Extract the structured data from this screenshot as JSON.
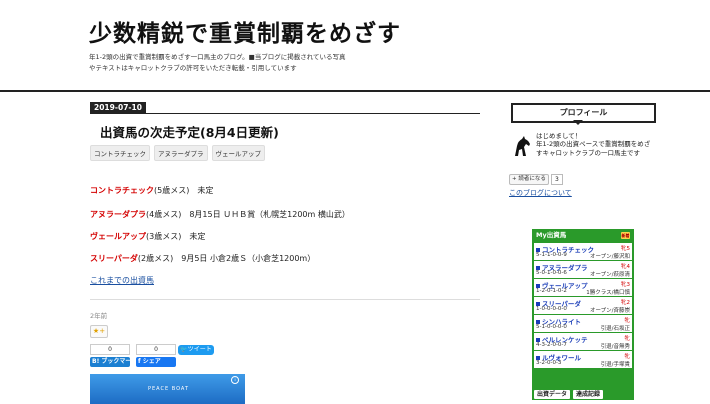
{
  "header": {
    "site_title": "少数精鋭で重賞制覇をめざす",
    "description_line1": "年1-2頭の出資で重賞制覇をめざす一口馬主のブログ。■当ブログに掲載されている写真",
    "description_line2": "やテキストはキャロットクラブの許可をいただき転載・引用しています"
  },
  "post": {
    "date": "2019-07-10",
    "title": "出資馬の次走予定(8月4日更新)",
    "tags": [
      "コントラチェック",
      "アヌラーダプラ",
      "ヴェールアップ"
    ],
    "horses": [
      {
        "name": "コントラチェック",
        "info": "(5歳メス)　未定"
      },
      {
        "name": "アヌラーダプラ",
        "info": "(4歳メス)　8月15日 ＵＨＢ賞（札幌芝1200m 横山武）"
      },
      {
        "name": "ヴェールアップ",
        "info": "(3歳メス)　未定"
      },
      {
        "name": "スリーパーダ",
        "info": "(2歳メス)　9月5日 小倉2歳Ｓ（小倉芝1200m）"
      }
    ],
    "more_link": "これまでの出資馬",
    "time_ago": "2年前",
    "star_label": "★+",
    "hatena": {
      "count": "0",
      "label": "B! ブックマーク"
    },
    "facebook": {
      "count": "0",
      "label": "f シェア"
    },
    "tweet_label": "ツイート",
    "ad_text": "PEACE BOAT",
    "ad_info": "i"
  },
  "sidebar": {
    "profile_heading": "プロフィール",
    "profile_name": "はじめまして！",
    "profile_bio": "年1-2頭の出資ペースで重賞制覇をめざすキャロットクラブの一口馬主です",
    "reader_label": "読者になる",
    "reader_count": "3",
    "about_link": "このブログについて",
    "my_horses": {
      "title": "My出資馬",
      "mark": "新着",
      "items": [
        {
          "name": "コントラチェック",
          "sex_age": "牝5",
          "record": "5-1-1-0-0-9",
          "trainer": "オープン/藤沢和",
          "color": "#1a3db8"
        },
        {
          "name": "アヌラーダプラ",
          "sex_age": "牝4",
          "record": "5-0-1-0-0-6",
          "trainer": "オープン/萩原清",
          "color": "#1a3db8"
        },
        {
          "name": "ヴェールアップ",
          "sex_age": "牝3",
          "record": "1-2-0-1-0-2",
          "trainer": "1勝クラス/橋口慎",
          "color": "#1a3db8"
        },
        {
          "name": "スリーパーダ",
          "sex_age": "牝2",
          "record": "1-0-0-0-0-0",
          "trainer": "オープン/斉藤崇",
          "color": "#1a3db8"
        },
        {
          "name": "シンハライト",
          "sex_age": "牝",
          "record": "5-1-0-0-0-0",
          "trainer": "引退/石坂正",
          "color": "#1a3db8"
        },
        {
          "name": "ペルレンケッテ",
          "sex_age": "牝",
          "record": "4-3-2-0-0-7",
          "trainer": "引退/音無秀",
          "color": "#1a3db8"
        },
        {
          "name": "ルヴォワール",
          "sex_age": "牝",
          "record": "3-2-0-0-3",
          "trainer": "引退/手塚貴",
          "color": "#1a3db8"
        }
      ],
      "tab_data": "出資データ",
      "tab_record": "達成記録"
    }
  }
}
